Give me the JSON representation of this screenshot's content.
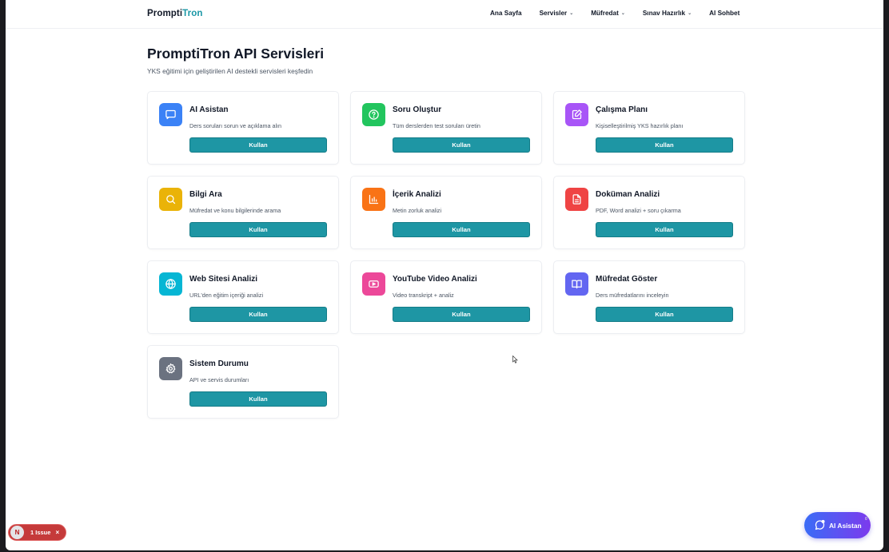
{
  "header": {
    "brand_prefix": "Prompti",
    "brand_suffix": "Tron",
    "nav": [
      {
        "label": "Ana Sayfa",
        "dropdown": false
      },
      {
        "label": "Servisler",
        "dropdown": true
      },
      {
        "label": "Müfredat",
        "dropdown": true
      },
      {
        "label": "Sınav Hazırlık",
        "dropdown": true
      },
      {
        "label": "AI Sohbet",
        "dropdown": false
      }
    ]
  },
  "page": {
    "title": "PromptiTron API Servisleri",
    "subtitle": "YKS eğitimi için geliştirilen AI destekli servisleri keşfedin"
  },
  "cards": [
    {
      "title": "AI Asistan",
      "description": "Ders soruları sorun ve açıklama alın",
      "button": "Kullan",
      "icon": "chat-icon",
      "color": "#3b82f6"
    },
    {
      "title": "Soru Oluştur",
      "description": "Tüm derslerden test soruları üretin",
      "button": "Kullan",
      "icon": "help-circle-icon",
      "color": "#22c55e"
    },
    {
      "title": "Çalışma Planı",
      "description": "Kişiselleştirilmiş YKS hazırlık planı",
      "button": "Kullan",
      "icon": "edit-note-icon",
      "color": "#a855f7"
    },
    {
      "title": "Bilgi Ara",
      "description": "Müfredat ve konu bilgilerinde arama",
      "button": "Kullan",
      "icon": "search-icon",
      "color": "#eab308"
    },
    {
      "title": "İçerik Analizi",
      "description": "Metin zorluk analizi",
      "button": "Kullan",
      "icon": "bar-chart-icon",
      "color": "#f97316"
    },
    {
      "title": "Doküman Analizi",
      "description": "PDF, Word analizi + soru çıkarma",
      "button": "Kullan",
      "icon": "document-icon",
      "color": "#ef4444"
    },
    {
      "title": "Web Sitesi Analizi",
      "description": "URL'den eğitim içeriği analizi",
      "button": "Kullan",
      "icon": "globe-icon",
      "color": "#06b6d4"
    },
    {
      "title": "YouTube Video Analizi",
      "description": "Video transkript + analiz",
      "button": "Kullan",
      "icon": "youtube-icon",
      "color": "#ec4899"
    },
    {
      "title": "Müfredat Göster",
      "description": "Ders müfredatlarını inceleyin",
      "button": "Kullan",
      "icon": "book-open-icon",
      "color": "#6366f1"
    },
    {
      "title": "Sistem Durumu",
      "description": "API ve servis durumları",
      "button": "Kullan",
      "icon": "settings-icon",
      "color": "#6b7280"
    }
  ],
  "widgets": {
    "issue_badge_letter": "N",
    "issue_label": "1 Issue",
    "issue_close": "×",
    "assistant_label": "AI Asistan",
    "assistant_dot": "0"
  }
}
